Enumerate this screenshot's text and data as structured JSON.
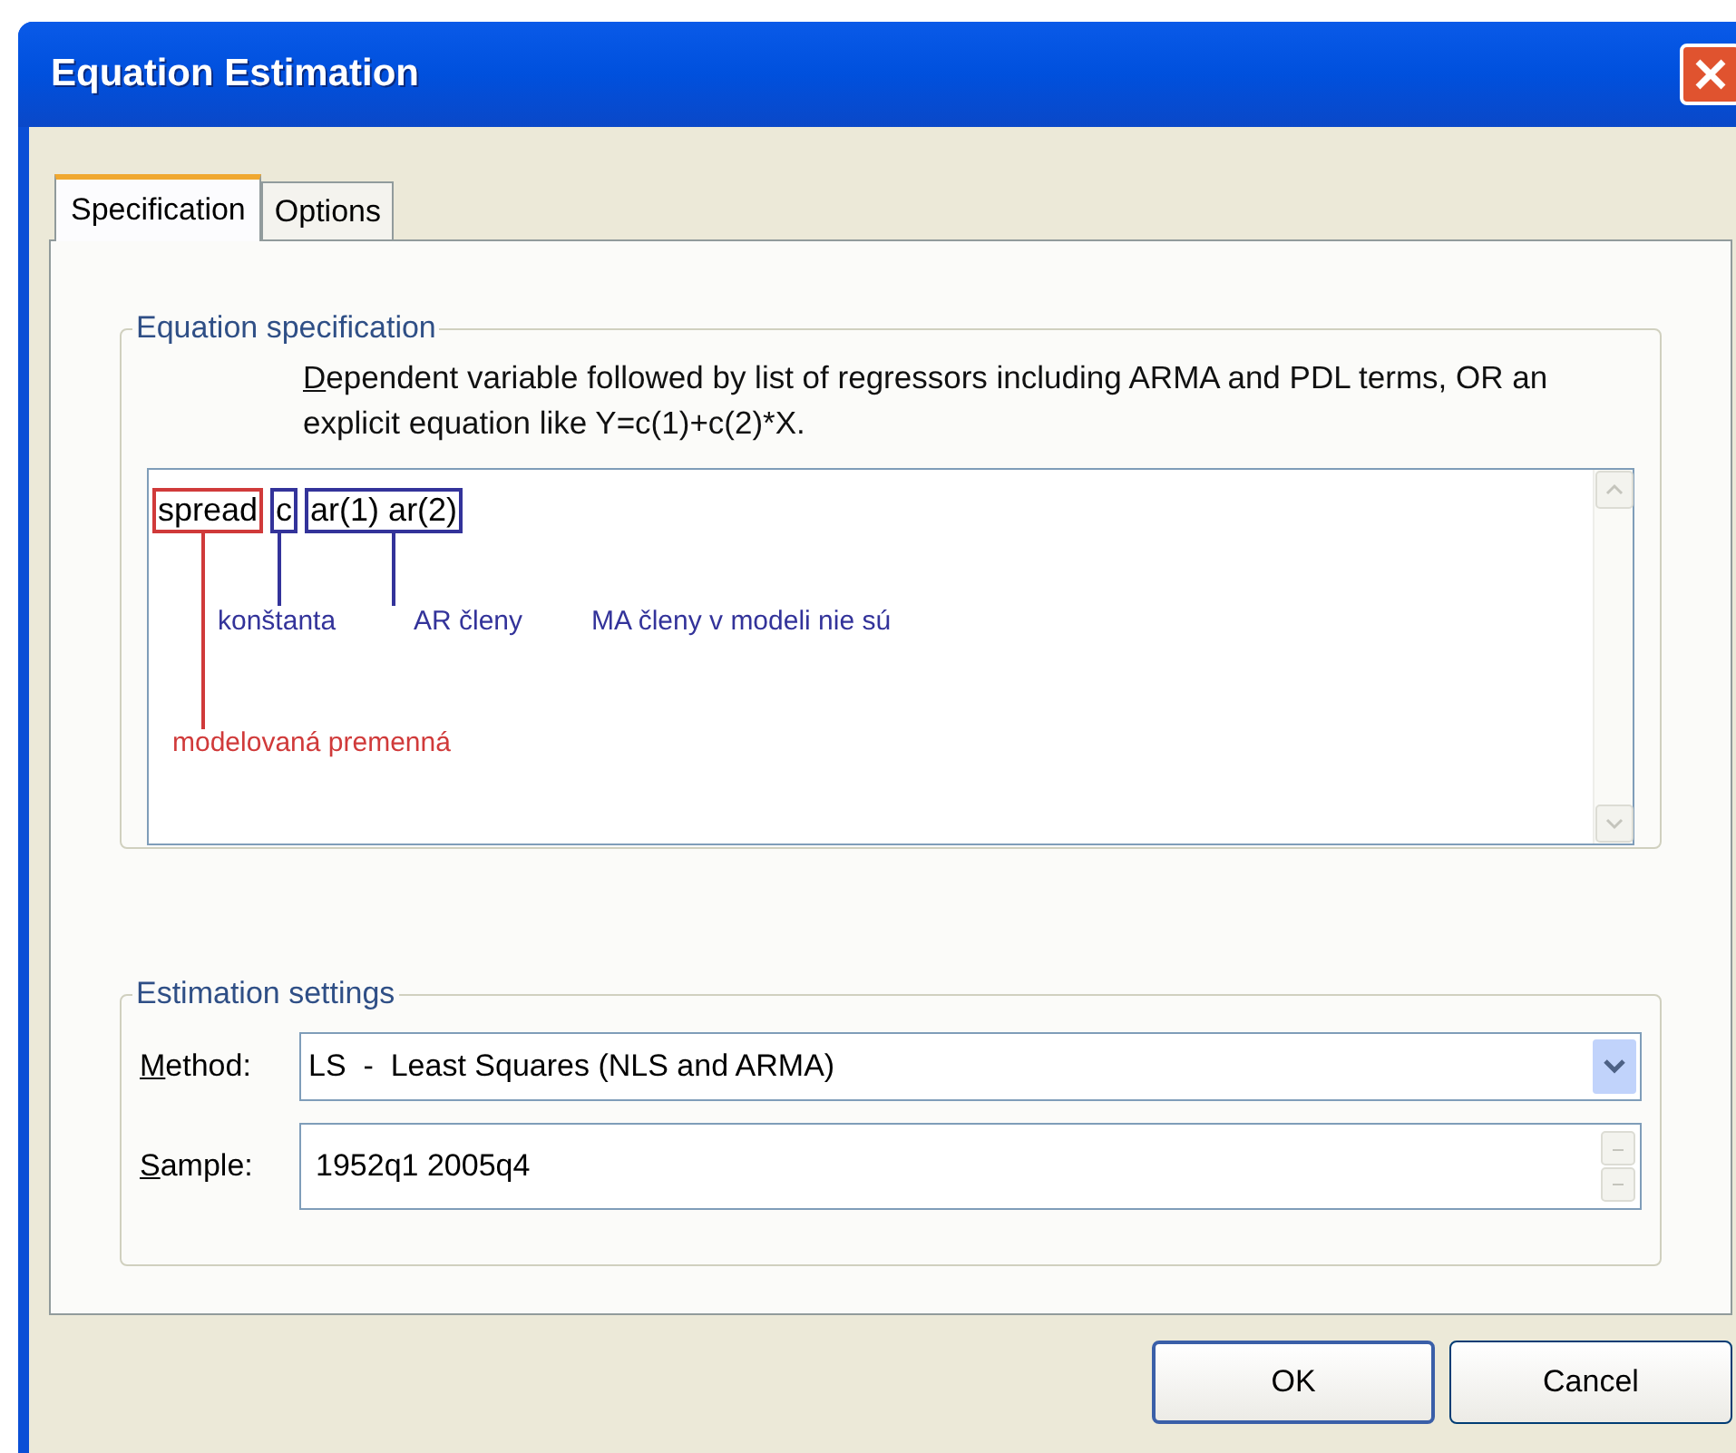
{
  "window": {
    "title": "Equation Estimation"
  },
  "tabs": [
    {
      "label": "Specification",
      "selected": true
    },
    {
      "label": "Options",
      "selected": false
    }
  ],
  "equation_specification": {
    "legend": "Equation specification",
    "hint": "Dependent variable followed by list of regressors including ARMA and PDL terms, OR an explicit equation like Y=c(1)+c(2)*X.",
    "terms": [
      {
        "text": "spread",
        "color": "#d03a3a"
      },
      {
        "text": "c",
        "color": "#33339a"
      },
      {
        "text": "ar(1) ar(2)",
        "color": "#33339a"
      }
    ],
    "annotations": [
      {
        "text": "konštanta",
        "color": "#33339a"
      },
      {
        "text": "AR členy",
        "color": "#33339a"
      },
      {
        "text": "MA členy v modeli nie sú",
        "color": "#33339a"
      },
      {
        "text": "modelovaná premenná",
        "color": "#d03a3a"
      }
    ]
  },
  "estimation_settings": {
    "legend": "Estimation settings",
    "method": {
      "label": "Method:",
      "value": "LS  -  Least Squares (NLS and ARMA)"
    },
    "sample": {
      "label": "Sample:",
      "value": "1952q1 2005q4"
    }
  },
  "buttons": [
    "OK",
    "Cancel"
  ]
}
